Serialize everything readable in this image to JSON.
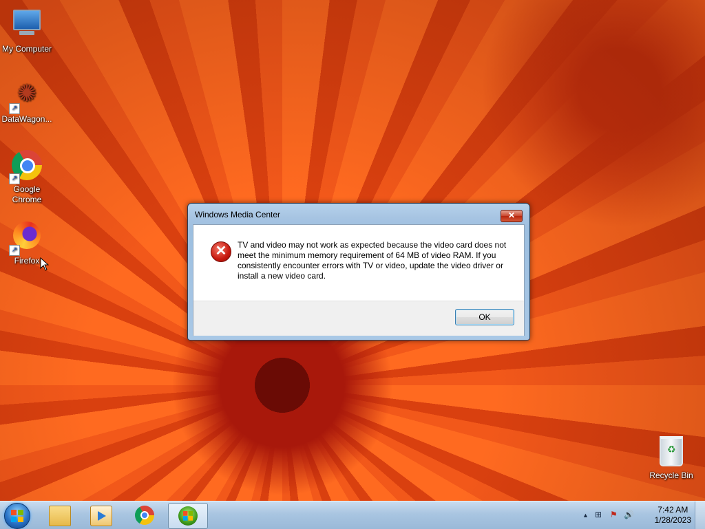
{
  "desktop": {
    "icons": [
      {
        "label": "My Computer"
      },
      {
        "label": "DataWagon..."
      },
      {
        "label": "Google Chrome"
      },
      {
        "label": "Firefox"
      },
      {
        "label": "Recycle Bin"
      }
    ]
  },
  "dialog": {
    "title": "Windows Media Center",
    "close_glyph": "✕",
    "error_glyph": "✕",
    "message": "TV and video may not work as expected because the video card does not meet the minimum memory requirement of 64 MB of video RAM. If you consistently encounter errors with TV or video, update the video driver or install a new video card.",
    "ok_label": "OK"
  },
  "taskbar": {
    "pinned": [
      {
        "icon": "windows-explorer-icon"
      },
      {
        "icon": "windows-media-player-icon"
      },
      {
        "icon": "google-chrome-icon"
      },
      {
        "icon": "windows-media-center-icon"
      }
    ],
    "tray": {
      "expand_glyph": "▲",
      "network_glyph": "⊞",
      "flag_glyph": "⚑",
      "volume_glyph": "🔊",
      "time": "7:42 AM",
      "date": "1/28/2023"
    }
  },
  "colors": {
    "wallpaper": "#e8501a",
    "taskbar": "#a9c5e1",
    "dialog_frame": "#a7c4e2",
    "error_red": "#c8190e"
  }
}
